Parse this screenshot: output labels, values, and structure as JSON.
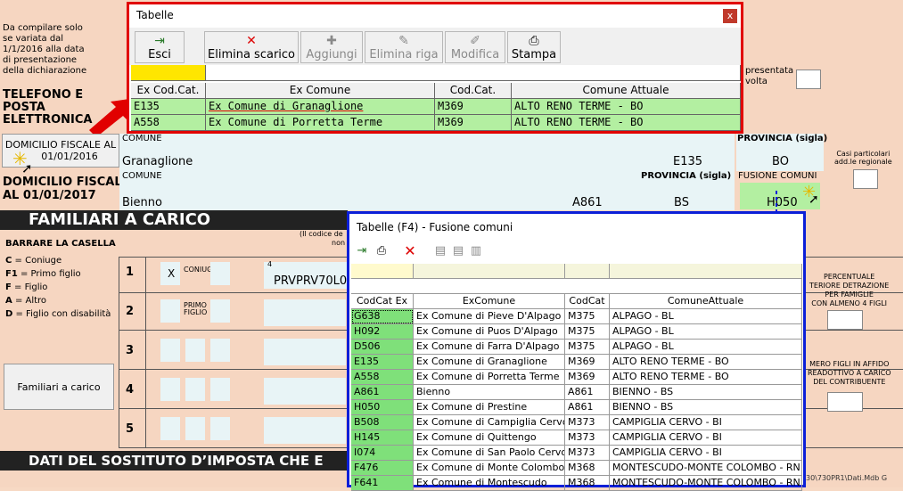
{
  "form": {
    "side_note": [
      "Da compilare solo",
      "se variata dal",
      "1/1/2016 alla data",
      "di presentazione",
      "della dichiarazione"
    ],
    "telefono_label": [
      "TELEFONO E",
      "POSTA",
      "ELETTRONICA"
    ],
    "domicilio_2016_button": [
      "DOMICILIO FISCALE AL",
      "01/01/2016"
    ],
    "comune_label": "COMUNE",
    "comune_2016_value": "Granaglione",
    "code_2016": "E135",
    "provincia_label": "PROVINCIA (sigla)",
    "provincia_2016_value": "BO",
    "casi_particolari": [
      "Casi particolari",
      "add.le regionale"
    ],
    "presentata_volta": [
      "presentata",
      "volta"
    ],
    "domicilio_2017_label": [
      "DOMICILIO FISCALE",
      "AL 01/01/2017"
    ],
    "comune_2017_value": "Bienno",
    "code_2017": "A861",
    "provincia_2017_value": "BS",
    "fusione_label": "FUSIONE COMUNI",
    "fusione_value": "H050",
    "familiari_title": "FAMILIARI A CARICO",
    "barrare": "BARRARE LA CASELLA",
    "legend": [
      {
        "key": "C",
        "text": "= Coniuge"
      },
      {
        "key": "F1",
        "text": "= Primo figlio"
      },
      {
        "key": "F",
        "text": "= Figlio"
      },
      {
        "key": "A",
        "text": "= Altro"
      },
      {
        "key": "D",
        "text": "= Figlio con disabilità"
      }
    ],
    "row_numbers": [
      "1",
      "2",
      "3",
      "4",
      "5"
    ],
    "row1_x": "X",
    "coniuge_label": "CONIUGE",
    "primo_figlio_label": [
      "PRIMO",
      "FIGLIO"
    ],
    "cf_header_partial": [
      "(Il codice de",
      "non"
    ],
    "cf_value_partial": "PRVPRV70L0",
    "field_4_label": "4",
    "familiari_button": "Familiari a carico",
    "percentuale_label": [
      "PERCENTUALE",
      "TERIORE DETRAZIONE",
      "PER FAMIGLIE",
      "CON ALMENO 4 FIGLI"
    ],
    "numero_figli_label": [
      "MERO FIGLI IN AFFIDO",
      "READOTTIVO A CARICO",
      "DEL CONTRIBUENTE"
    ],
    "dati_sostituto": "DATI DEL SOSTITUTO D’IMPOSTA CHE E",
    "footer_partial": "30\\730PR1\\Dati.Mdb G"
  },
  "dialog1": {
    "title": "Tabelle",
    "close": "x",
    "buttons": [
      {
        "label": "Esci",
        "icon": "exit-icon",
        "disabled": false
      },
      {
        "label": "Elimina scarico",
        "icon": "delete-icon",
        "disabled": false
      },
      {
        "label": "Aggiungi",
        "icon": "add-icon",
        "disabled": true
      },
      {
        "label": "Elimina riga",
        "icon": "delete-row-icon",
        "disabled": true
      },
      {
        "label": "Modifica",
        "icon": "edit-icon",
        "disabled": true
      },
      {
        "label": "Stampa",
        "icon": "print-icon",
        "disabled": false
      }
    ],
    "columns": [
      "Ex Cod.Cat.",
      "Ex Comune",
      "Cod.Cat.",
      "Comune Attuale"
    ],
    "rows": [
      [
        "E135",
        "Ex Comune di Granaglione",
        "M369",
        "ALTO RENO TERME - BO"
      ],
      [
        "A558",
        "Ex Comune di Porretta Terme",
        "M369",
        "ALTO RENO TERME - BO"
      ]
    ]
  },
  "dialog2": {
    "title": "Tabelle (F4) - Fusione comuni",
    "columns": [
      "CodCat Ex",
      "ExComune",
      "CodCat",
      "ComuneAttuale"
    ],
    "rows": [
      [
        "G638",
        "Ex Comune di Pieve D'Alpago",
        "M375",
        "ALPAGO - BL"
      ],
      [
        "H092",
        "Ex Comune di Puos D'Alpago",
        "M375",
        "ALPAGO - BL"
      ],
      [
        "D506",
        "Ex Comune di Farra D'Alpago",
        "M375",
        "ALPAGO - BL"
      ],
      [
        "E135",
        "Ex Comune di Granaglione",
        "M369",
        "ALTO RENO TERME - BO"
      ],
      [
        "A558",
        "Ex Comune di Porretta Terme",
        "M369",
        "ALTO RENO TERME - BO"
      ],
      [
        "A861",
        "Bienno",
        "A861",
        "BIENNO - BS"
      ],
      [
        "H050",
        "Ex Comune di Prestine",
        "A861",
        "BIENNO - BS"
      ],
      [
        "B508",
        "Ex Comune di Campiglia Cervo",
        "M373",
        "CAMPIGLIA CERVO - BI"
      ],
      [
        "H145",
        "Ex Comune di Quittengo",
        "M373",
        "CAMPIGLIA CERVO - BI"
      ],
      [
        "I074",
        "Ex Comune di San Paolo Cervo",
        "M373",
        "CAMPIGLIA CERVO - BI"
      ],
      [
        "F476",
        "Ex Comune di Monte Colombo",
        "M368",
        "MONTESCUDO-MONTE COLOMBO - RN"
      ],
      [
        "F641",
        "Ex Comune di Montescudo",
        "M368",
        "MONTESCUDO-MONTE COLOMBO - RN"
      ]
    ]
  },
  "colors": {
    "dialog1_border": "#e10000",
    "dialog2_border": "#0b1fd8",
    "row_green": "#b3efa1",
    "form_bg": "#f6d6c1"
  }
}
